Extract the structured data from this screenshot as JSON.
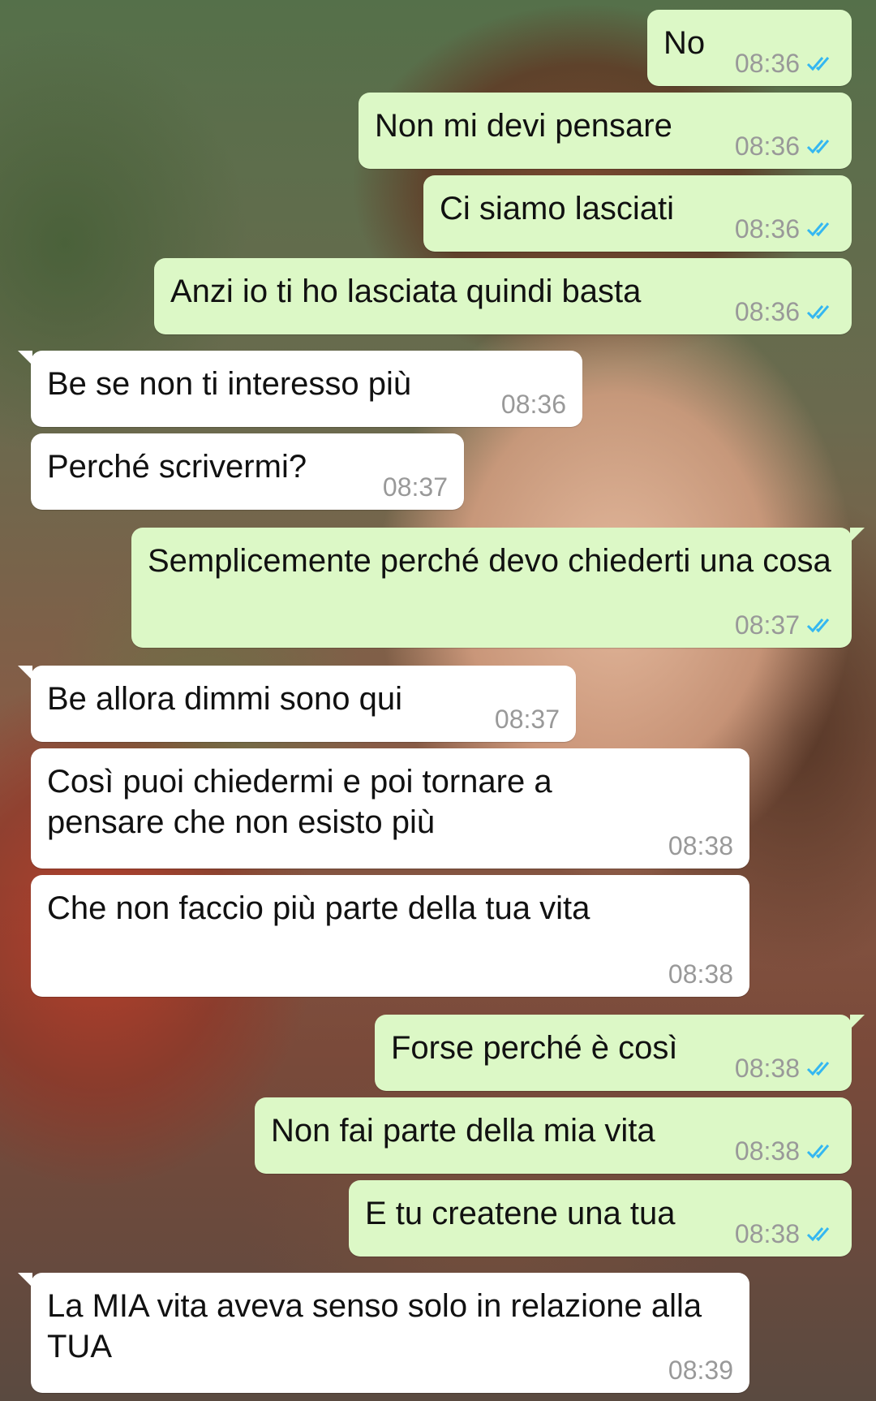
{
  "colors": {
    "outgoing_bubble": "#dcf8c6",
    "incoming_bubble": "#ffffff",
    "timestamp": "#999999",
    "read_ticks": "#34b7f1"
  },
  "messages": [
    {
      "direction": "out",
      "text": "No",
      "time": "08:36",
      "status": "read-double-check-icon"
    },
    {
      "direction": "out",
      "text": "Non mi devi pensare",
      "time": "08:36",
      "status": "read-double-check-icon"
    },
    {
      "direction": "out",
      "text": "Ci siamo lasciati",
      "time": "08:36",
      "status": "read-double-check-icon"
    },
    {
      "direction": "out",
      "text": "Anzi io ti ho lasciata quindi basta",
      "time": "08:36",
      "status": "read-double-check-icon"
    },
    {
      "direction": "in",
      "text": "Be se non ti interesso più",
      "time": "08:36"
    },
    {
      "direction": "in",
      "text": "Perché scrivermi?",
      "time": "08:37"
    },
    {
      "direction": "out",
      "text": "Semplicemente perché devo chiederti una cosa",
      "time": "08:37",
      "status": "read-double-check-icon"
    },
    {
      "direction": "in",
      "text": "Be allora dimmi sono qui",
      "time": "08:37"
    },
    {
      "direction": "in",
      "text": "Così puoi chiedermi e poi tornare a pensare che non esisto più",
      "time": "08:38"
    },
    {
      "direction": "in",
      "text": "Che non faccio più parte della tua vita",
      "time": "08:38"
    },
    {
      "direction": "out",
      "text": "Forse perché è così",
      "time": "08:38",
      "status": "read-double-check-icon"
    },
    {
      "direction": "out",
      "text": "Non fai parte della mia vita",
      "time": "08:38",
      "status": "read-double-check-icon"
    },
    {
      "direction": "out",
      "text": "E tu createne una tua",
      "time": "08:38",
      "status": "read-double-check-icon"
    },
    {
      "direction": "in",
      "text": "La MIA vita aveva senso solo in relazione alla TUA",
      "time": "08:39"
    }
  ]
}
